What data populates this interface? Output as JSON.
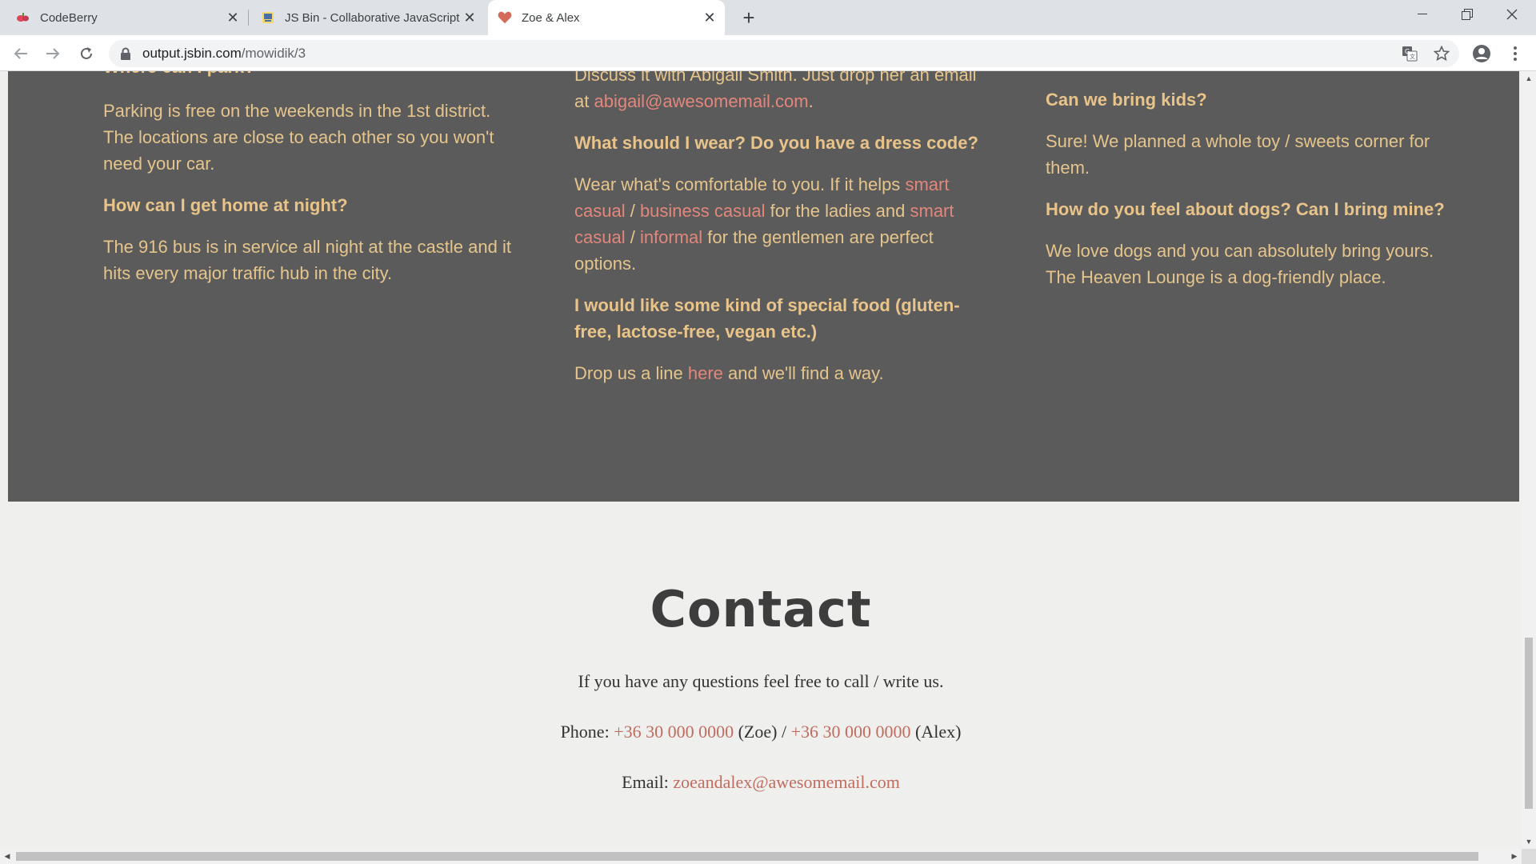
{
  "browser": {
    "tabs": [
      {
        "title": "CodeBerry",
        "icon": "codeberry-icon"
      },
      {
        "title": "JS Bin - Collaborative JavaScript D",
        "icon": "jsbin-icon"
      },
      {
        "title": "Zoe & Alex",
        "icon": "heart-icon"
      }
    ],
    "active_tab": 2,
    "url_host": "output.jsbin.com",
    "url_path": "/mowidik/3"
  },
  "faq": {
    "col1": {
      "partial_heading": "Where can I park?",
      "p1": "Parking is free on the weekends in the 1st district. The locations are close to each other so you won't need your car.",
      "q2": "How can I get home at night?",
      "p2": "The 916 bus is in service all night at the castle and it hits every major traffic hub in the city."
    },
    "col2": {
      "p1_text": "Discuss it with Abigail Smith. Just drop her an email at ",
      "p1_link": "abigail@awesomemail.com",
      "p1_end": ".",
      "q2": "What should I wear? Do you have a dress code?",
      "p2_a": "Wear what's comfortable to you. If it helps ",
      "p2_link1": "smart casual",
      "p2_sep1": " / ",
      "p2_link2": "business casual",
      "p2_b": " for the ladies and ",
      "p2_link3": "smart casual",
      "p2_sep2": " / ",
      "p2_link4": "informal",
      "p2_c": " for the gentlemen are perfect options.",
      "q3": "I would like some kind of special food (gluten-free, lactose-free, vegan etc.)",
      "p3_a": "Drop us a line ",
      "p3_link": "here",
      "p3_b": " and we'll find a way."
    },
    "col3": {
      "q1": "Can we bring kids?",
      "p1": "Sure! We planned a whole toy / sweets corner for them.",
      "q2": "How do you feel about dogs? Can I bring mine?",
      "p2": "We love dogs and you can absolutely bring yours. The Heaven Lounge is a dog-friendly place."
    }
  },
  "contact": {
    "title": "Contact",
    "intro": "If you have any questions feel free to call / write us.",
    "phone_label": "Phone: ",
    "phone1": "+36 30 000 0000",
    "phone1_name": " (Zoe) / ",
    "phone2": "+36 30 000 0000",
    "phone2_name": " (Alex)",
    "email_label": "Email: ",
    "email": "zoeandalex@awesomemail.com"
  },
  "colors": {
    "faq_bg": "#5b5b5b",
    "faq_text": "#e6c58d",
    "link": "#e2877c",
    "page_bg": "#efefed"
  }
}
